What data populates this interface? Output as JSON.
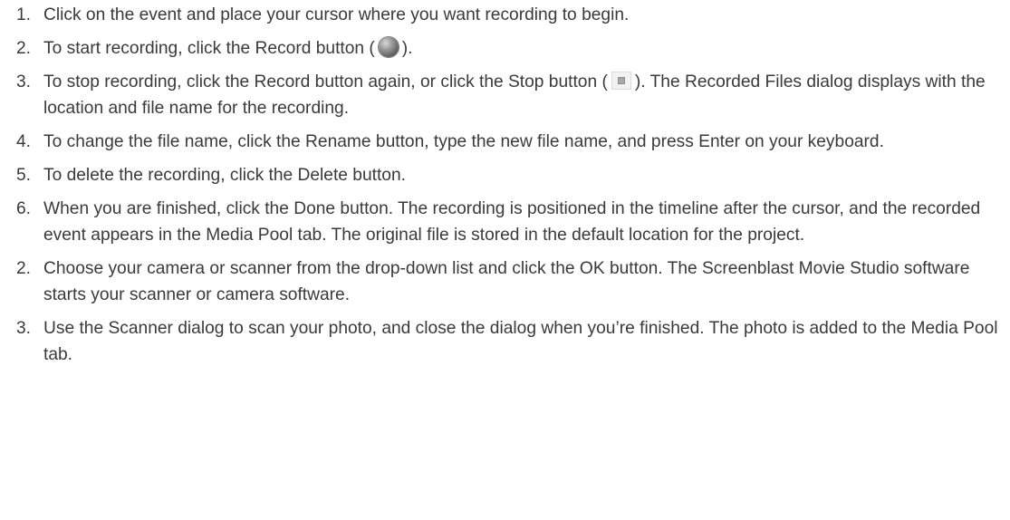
{
  "items": [
    {
      "num": "1.",
      "text": "Click on the event and place your cursor where you want recording to begin."
    },
    {
      "num": "2.",
      "before": "To start recording, click the Record button (",
      "after": ")."
    },
    {
      "num": "3.",
      "before": "To stop recording, click the Record button again, or click the Stop button (",
      "after": "). The Recorded Files dialog displays with the location and file name for the recording."
    },
    {
      "num": "4.",
      "text": "To change the file name, click the Rename button, type the new file name, and press Enter on your keyboard."
    },
    {
      "num": "5.",
      "text": "To delete the recording, click the Delete button."
    },
    {
      "num": "6.",
      "text": "When you are finished, click the Done button. The recording is positioned in the timeline after the cursor, and the recorded event appears in the Media Pool tab. The original file is stored in the default location for the project."
    },
    {
      "num": "2.",
      "text": "Choose your camera or scanner from the drop-down list and click the OK button. The Screenblast Movie Studio software starts your scanner or camera software."
    },
    {
      "num": "3.",
      "text": "Use the Scanner dialog to scan your photo, and close the dialog when you’re finished. The photo is added to the Media Pool tab."
    }
  ],
  "icons": {
    "record": "record-button-icon",
    "stop": "stop-button-icon"
  }
}
